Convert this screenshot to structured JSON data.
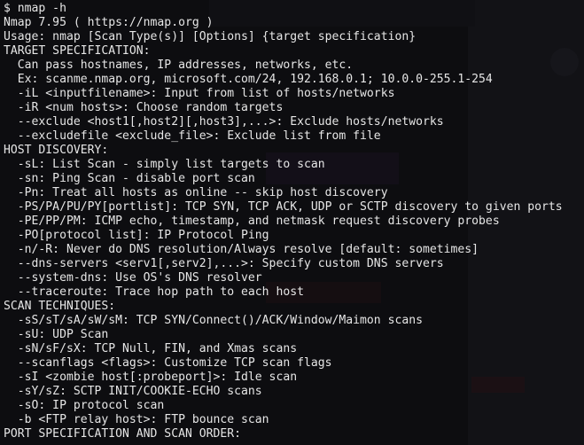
{
  "terminal": {
    "background": "#0d0d10",
    "foreground": "#e6e6e6",
    "lines": [
      "$ nmap -h",
      "Nmap 7.95 ( https://nmap.org )",
      "Usage: nmap [Scan Type(s)] [Options] {target specification}",
      "TARGET SPECIFICATION:",
      "  Can pass hostnames, IP addresses, networks, etc.",
      "  Ex: scanme.nmap.org, microsoft.com/24, 192.168.0.1; 10.0.0-255.1-254",
      "  -iL <inputfilename>: Input from list of hosts/networks",
      "  -iR <num hosts>: Choose random targets",
      "  --exclude <host1[,host2][,host3],...>: Exclude hosts/networks",
      "  --excludefile <exclude_file>: Exclude list from file",
      "HOST DISCOVERY:",
      "  -sL: List Scan - simply list targets to scan",
      "  -sn: Ping Scan - disable port scan",
      "  -Pn: Treat all hosts as online -- skip host discovery",
      "  -PS/PA/PU/PY[portlist]: TCP SYN, TCP ACK, UDP or SCTP discovery to given ports",
      "  -PE/PP/PM: ICMP echo, timestamp, and netmask request discovery probes",
      "  -PO[protocol list]: IP Protocol Ping",
      "  -n/-R: Never do DNS resolution/Always resolve [default: sometimes]",
      "  --dns-servers <serv1[,serv2],...>: Specify custom DNS servers",
      "  --system-dns: Use OS's DNS resolver",
      "  --traceroute: Trace hop path to each host",
      "SCAN TECHNIQUES:",
      "  -sS/sT/sA/sW/sM: TCP SYN/Connect()/ACK/Window/Maimon scans",
      "  -sU: UDP Scan",
      "  -sN/sF/sX: TCP Null, FIN, and Xmas scans",
      "  --scanflags <flags>: Customize TCP scan flags",
      "  -sI <zombie host[:probeport]>: Idle scan",
      "  -sY/sZ: SCTP INIT/COOKIE-ECHO scans",
      "  -sO: IP protocol scan",
      "  -b <FTP relay host>: FTP bounce scan",
      "PORT SPECIFICATION AND SCAN ORDER:"
    ]
  }
}
